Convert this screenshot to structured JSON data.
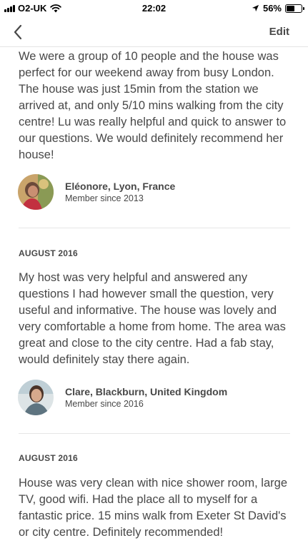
{
  "status_bar": {
    "carrier": "O2-UK",
    "time": "22:02",
    "battery_percent": "56%",
    "battery_level": 0.56,
    "signal_icon": "cellular-signal-icon",
    "wifi_icon": "wifi-icon",
    "location_icon": "location-arrow-icon",
    "battery_icon": "battery-icon"
  },
  "nav": {
    "back_icon": "chevron-left-icon",
    "edit_label": "Edit"
  },
  "reviews": [
    {
      "date": "",
      "text": "We were a group of 10 people and the house was perfect for our weekend away from busy London. The house was just 15min from the station we arrived at, and only 5/10 mins walking from the city centre! Lu was really helpful and quick to answer to our questions. We would definitely recommend her house!",
      "reviewer_name": "Eléonore, Lyon, France",
      "member_since": "Member since 2013"
    },
    {
      "date": "AUGUST 2016",
      "text": "My host was very helpful and answered any questions I had however small the question, very useful and informative. The house was lovely and very comfortable a home from home. The area was great and close to the city centre. Had a fab stay, would definitely stay there again.",
      "reviewer_name": "Clare, Blackburn, United Kingdom",
      "member_since": "Member since 2016"
    },
    {
      "date": "AUGUST 2016",
      "text": "House was very clean with nice shower room, large TV, good wifi. Had the place all to myself for a fantastic price. 15 mins walk from Exeter St David's or city centre. Definitely recommended!",
      "reviewer_name": "",
      "member_since": ""
    }
  ]
}
